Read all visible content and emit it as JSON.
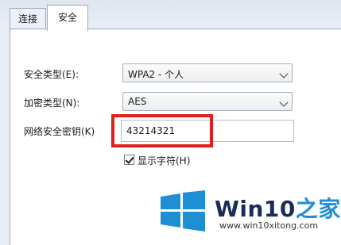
{
  "tabs": [
    {
      "label": "连接",
      "active": false
    },
    {
      "label": "安全",
      "active": true
    }
  ],
  "form": {
    "security_type": {
      "label": "安全类型(E):",
      "value": "WPA2 - 个人"
    },
    "encryption_type": {
      "label": "加密类型(N):",
      "value": "AES"
    },
    "network_key": {
      "label": "网络安全密钥(K)",
      "value": "43214321"
    },
    "show_chars": {
      "label": "显示字符(H)",
      "checked": true
    }
  },
  "highlight": {
    "color": "#e0201b"
  },
  "watermark": {
    "title_prefix": "Win10",
    "title_suffix": "之家",
    "subtitle": "www.win10xitong.com",
    "logo": "windows-logo-icon",
    "logo_color": "#1e8fd5",
    "suffix_color": "#1e8fd5"
  }
}
